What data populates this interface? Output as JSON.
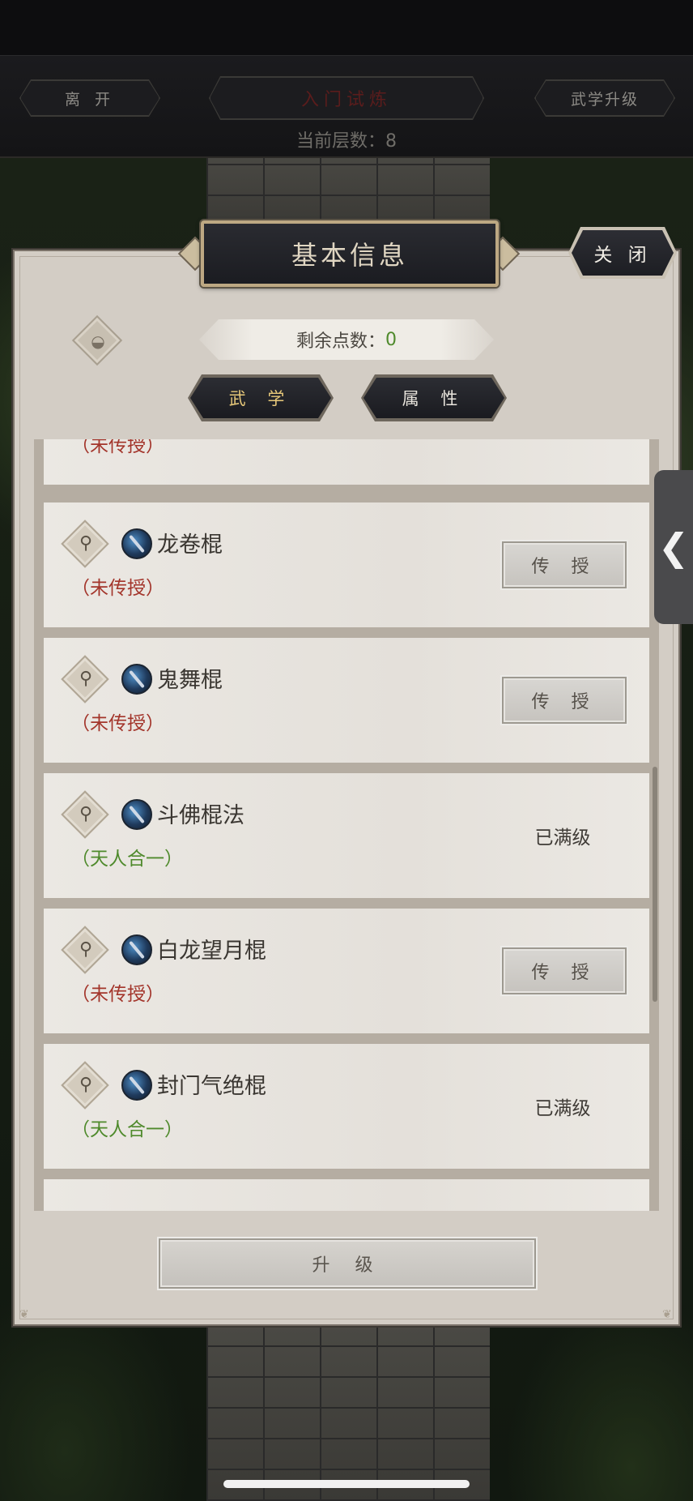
{
  "top_bar": {
    "leave_label": "离 开",
    "trial_label": "入门试炼",
    "martial_upgrade_label": "武学升级",
    "layer_label": "当前层数：",
    "layer_value": "8"
  },
  "panel": {
    "title": "基本信息",
    "close_label": "关 闭",
    "points_label": "剩余点数：",
    "points_value": "0",
    "tabs": [
      {
        "label": "武 学",
        "active": true
      },
      {
        "label": "属 性",
        "active": false
      }
    ],
    "partial_top_status": "（未传授）",
    "skills": [
      {
        "name": "龙卷棍",
        "status": "（未传授）",
        "status_type": "untaught",
        "action": "传 授"
      },
      {
        "name": "鬼舞棍",
        "status": "（未传授）",
        "status_type": "untaught",
        "action": "传 授"
      },
      {
        "name": "斗佛棍法",
        "status": "（天人合一）",
        "status_type": "master",
        "action": "已满级"
      },
      {
        "name": "白龙望月棍",
        "status": "（未传授）",
        "status_type": "untaught",
        "action": "传 授"
      },
      {
        "name": "封门气绝棍",
        "status": "（天人合一）",
        "status_type": "master",
        "action": "已满级"
      }
    ],
    "upgrade_label": "升 级"
  },
  "side_tab_glyph": "❮",
  "colors": {
    "untaught": "#a3352b",
    "master": "#4f8a2c",
    "active_tab_text": "#e8c97a"
  },
  "icons": {
    "eye": "eye-icon",
    "search": "magnifier-icon",
    "skill": "staff-skill-icon"
  }
}
